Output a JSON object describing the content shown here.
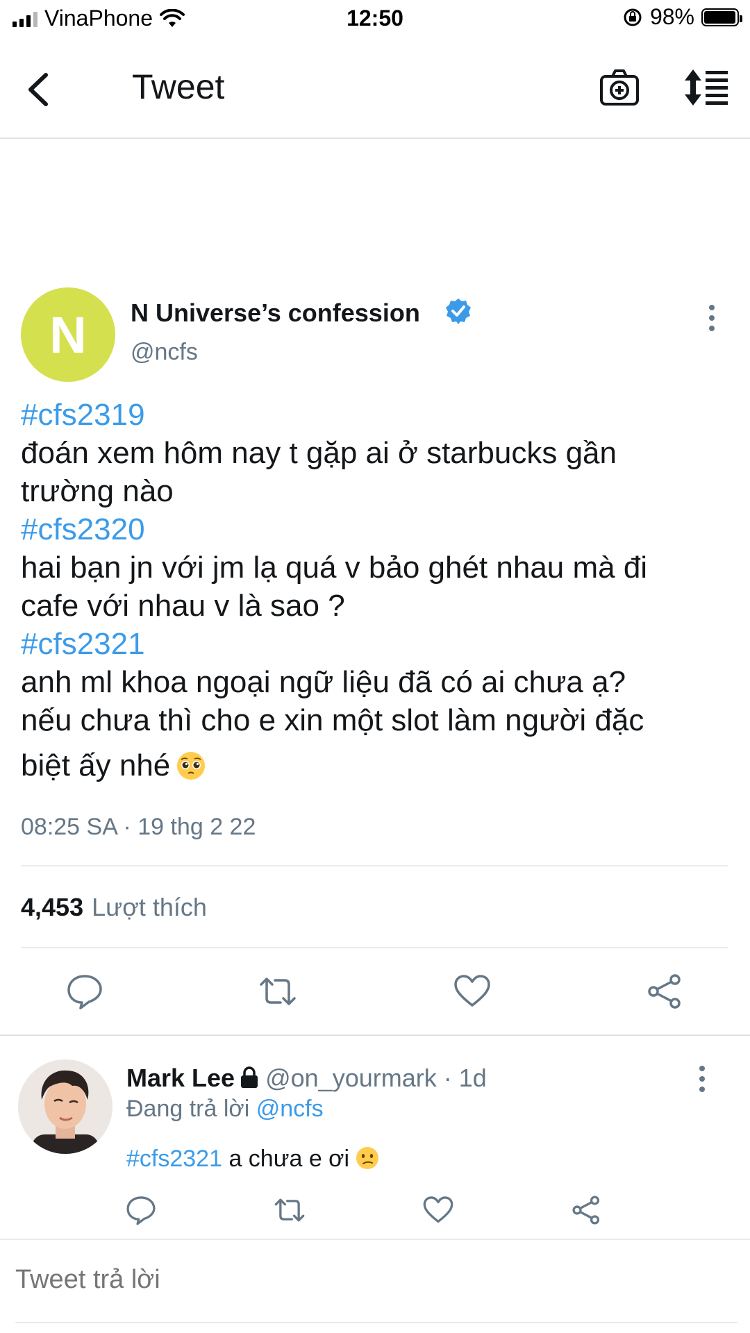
{
  "status_bar": {
    "carrier": "VinaPhone",
    "time": "12:50",
    "battery_percent": "98%",
    "battery_level": 0.98,
    "icons": [
      "signal-icon",
      "wifi-icon",
      "rotation-lock-icon",
      "battery-icon"
    ]
  },
  "nav": {
    "title": "Tweet",
    "icons": [
      "back-arrow-icon",
      "camera-plus-icon",
      "sort-icon"
    ]
  },
  "tweet": {
    "author_initial": "N",
    "author_name": "N Universe’s confession",
    "author_handle": "@ncfs",
    "verified": true,
    "avatar_color": "#d4e04e",
    "body_lines": [
      {
        "hashtag": "#cfs2319",
        "text": ""
      },
      {
        "hashtag": "",
        "text": "đoán xem hôm nay t gặp ai ở starbucks gần"
      },
      {
        "hashtag": "",
        "text": "trường nào"
      },
      {
        "hashtag": "#cfs2320",
        "text": ""
      },
      {
        "hashtag": "",
        "text": "hai bạn jn với jm lạ quá v bảo ghét nhau mà đi"
      },
      {
        "hashtag": "",
        "text": "cafe với nhau v là sao ?"
      },
      {
        "hashtag": "#cfs2321",
        "text": ""
      },
      {
        "hashtag": "",
        "text": "anh ml khoa ngoại ngữ liệu đã có ai chưa ạ?"
      },
      {
        "hashtag": "",
        "text": "nếu chưa thì cho e xin một slot làm người đặc"
      },
      {
        "hashtag": "",
        "text": "biệt ấy nhé"
      }
    ],
    "timestamp": "08:25 SA · 19 thg 2 22",
    "likes_count": "4,453",
    "likes_label": "Lượt thích",
    "actions": [
      "reply-icon",
      "retweet-icon",
      "like-icon",
      "share-icon"
    ]
  },
  "reply": {
    "name": "Mark Lee",
    "handle_meta": "@on_yourmark · 1d",
    "replying_label": "Đang trả lời",
    "replying_mention": "@ncfs",
    "hashtag": "#cfs2321",
    "text": " a chưa e ơi",
    "actions": [
      "reply-icon",
      "retweet-icon",
      "like-icon",
      "share-icon"
    ]
  },
  "compose": {
    "placeholder": "Tweet trả lời"
  },
  "colors": {
    "accent": "#3b9be9",
    "secondary_text": "#657786",
    "primary_text": "#14171a",
    "divider": "#e6ecf0"
  }
}
